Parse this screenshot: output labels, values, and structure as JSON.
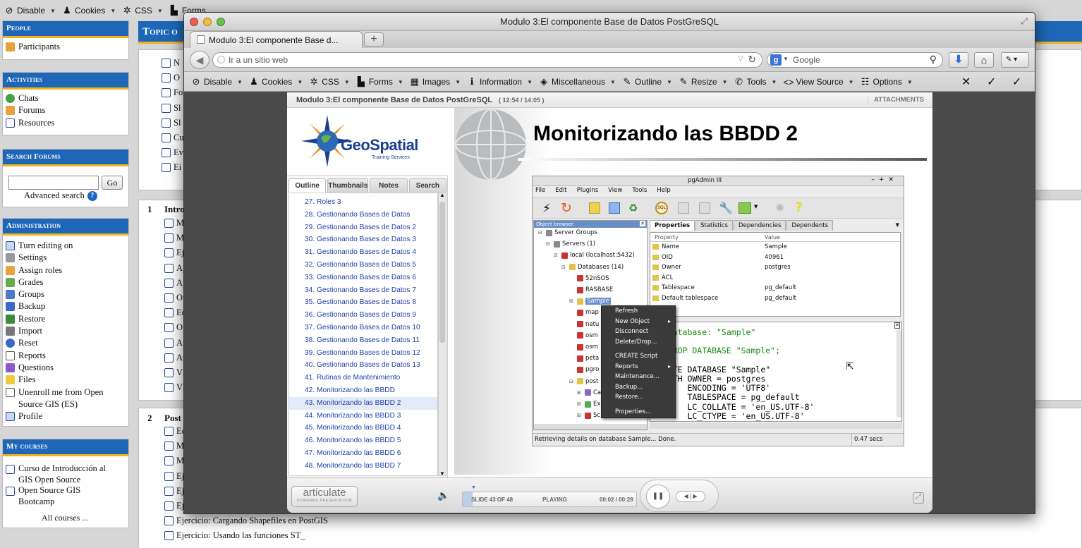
{
  "webdev_toolbar": {
    "items": [
      "Disable",
      "Cookies",
      "CSS",
      "Forms",
      "Images",
      "Information",
      "Miscellaneous",
      "Outline",
      "Resize",
      "Tools",
      "View Source",
      "Options"
    ]
  },
  "moodle": {
    "topic_header": "Topic o",
    "blocks": {
      "people": {
        "title": "People",
        "items": [
          "Participants"
        ]
      },
      "activities": {
        "title": "Activities",
        "items": [
          "Chats",
          "Forums",
          "Resources"
        ]
      },
      "search": {
        "title": "Search Forums",
        "button": "Go",
        "advanced": "Advanced search"
      },
      "admin": {
        "title": "Administration",
        "items": [
          "Turn editing on",
          "Settings",
          "Assign roles",
          "Grades",
          "Groups",
          "Backup",
          "Restore",
          "Import",
          "Reset",
          "Reports",
          "Questions",
          "Files",
          "Unenroll me from Open",
          "Source GIS (ES)",
          "Profile"
        ]
      },
      "courses": {
        "title": "My courses",
        "items": [
          "Curso de Introducción al",
          "GIS Open Source",
          "Open Source GIS",
          "Bootcamp"
        ],
        "all": "All courses ..."
      }
    },
    "topic1_num": "1",
    "topic1_title": "Intro",
    "topic2_num": "2",
    "topic2_title": "Post",
    "topic0_items": [
      "N",
      "O",
      "Fo",
      "Sl",
      "Sl",
      "Cu",
      "Ev",
      "Ei"
    ],
    "topic1_items": [
      "M",
      "M",
      "Ej",
      "Ap",
      "Ap",
      "O",
      "Ec",
      "O",
      "Ar",
      "Ap",
      "VI",
      "VI"
    ],
    "topic2_items": [
      "Ec",
      "M",
      "M",
      "Ej",
      "Ej",
      "Ej",
      "Ejercicio: Cargando Shapefiles en PostGIS",
      "Ejercicio: Usando las funciones ST_"
    ]
  },
  "browser": {
    "title": "Modulo 3:El componente Base de Datos PostGreSQL",
    "tab_label": "Modulo 3:El componente Base d...",
    "tab_add": "+",
    "url_placeholder": "Ir a un sitio web",
    "search_placeholder": "Google"
  },
  "player": {
    "header_title": "Modulo 3:El componente Base de Datos PostGreSQL",
    "header_time": "( 12:54 / 14:05 )",
    "attachments": "ATTACHMENTS",
    "logo_text": "GeoSpatial",
    "logo_sub": "Training Services",
    "tabs": [
      "Outline",
      "Thumbnails",
      "Notes",
      "Search"
    ],
    "outline": [
      "27. Roles 3",
      "28. Gestionando Bases de Datos",
      "29. Gestionando Bases de Datos 2",
      "30. Gestionando Bases de Datos 3",
      "31. Gestionando Bases de Datos 4",
      "32. Gestionando Bases de Datos 5",
      "33. Gestionando Bases de Datos 6",
      "34. Gestionando Bases de Datos 7",
      "35. Gestionando Bases de Datos 8",
      "36. Gestionando Bases de Datos 9",
      "37. Gestionando Bases de Datos 10",
      "38. Gestionando Bases de Datos 11",
      "39. Gestionando Bases de Datos 12",
      "40. Gestionando Bases de Datos 13",
      "41. Rutinas de Mantenimiento",
      "42. Monitorizando las BBDD",
      "43. Monitorizando las BBDD 2",
      "44. Monitorizando las BBDD 3",
      "45. Monitorizando las BBDD 4",
      "46. Monitorizando las BBDD 5",
      "47. Monitorizando las BBDD 6",
      "48. Monitorizando las BBDD 7"
    ],
    "selected_index": 16,
    "slide_title": "Monitorizando las BBDD 2",
    "footer": {
      "brand": "articulate",
      "brand_sub": "POWERED PRESENTATION",
      "slide": "SLIDE 43 OF 48",
      "status": "PLAYING",
      "time": "00:02 / 00:28"
    }
  },
  "pgadmin": {
    "title": "pgAdmin III",
    "menu": [
      "File",
      "Edit",
      "Plugins",
      "View",
      "Tools",
      "Help"
    ],
    "object_browser": "Object browser",
    "tree": [
      {
        "label": "Server Groups",
        "indent": 0,
        "exp": "⊟",
        "color": "#888"
      },
      {
        "label": "Servers (1)",
        "indent": 1,
        "exp": "⊟",
        "color": "#888"
      },
      {
        "label": "local (localhost:5432)",
        "indent": 2,
        "exp": "⊟",
        "color": "#c33"
      },
      {
        "label": "Databases (14)",
        "indent": 3,
        "exp": "⊟",
        "color": "#e2c44c"
      },
      {
        "label": "52nSOS",
        "indent": 4,
        "exp": "",
        "color": "#c33"
      },
      {
        "label": "RASBASE",
        "indent": 4,
        "exp": "",
        "color": "#c33"
      },
      {
        "label": "Sample",
        "indent": 4,
        "exp": "⊞",
        "color": "#e2c44c",
        "sel": true
      },
      {
        "label": "map",
        "indent": 4,
        "exp": "",
        "color": "#c33"
      },
      {
        "label": "natu",
        "indent": 4,
        "exp": "",
        "color": "#c33"
      },
      {
        "label": "osm",
        "indent": 4,
        "exp": "",
        "color": "#c33"
      },
      {
        "label": "osm",
        "indent": 4,
        "exp": "",
        "color": "#c33"
      },
      {
        "label": "peta",
        "indent": 4,
        "exp": "",
        "color": "#c33"
      },
      {
        "label": "pgro",
        "indent": 4,
        "exp": "",
        "color": "#c33"
      },
      {
        "label": "post",
        "indent": 4,
        "exp": "⊟",
        "color": "#e2c44c"
      },
      {
        "label": "Ca",
        "indent": 5,
        "exp": "⊞",
        "color": "#86c"
      },
      {
        "label": "Ex",
        "indent": 5,
        "exp": "⊞",
        "color": "#5a5"
      },
      {
        "label": "Sc",
        "indent": 5,
        "exp": "⊞",
        "color": "#c33"
      }
    ],
    "prop_tabs": [
      "Properties",
      "Statistics",
      "Dependencies",
      "Dependents"
    ],
    "prop_head": [
      "Property",
      "Value"
    ],
    "props": [
      [
        "Name",
        "Sample"
      ],
      [
        "OID",
        "40961"
      ],
      [
        "Owner",
        "postgres"
      ],
      [
        "ACL",
        ""
      ],
      [
        "Tablespace",
        "pg_default"
      ],
      [
        "Default tablespace",
        "pg_default"
      ]
    ],
    "sql_lines": [
      "-- Database: \"Sample\"",
      "",
      "-- DROP DATABASE \"Sample\";",
      "",
      "CREATE DATABASE \"Sample\"",
      "  WITH OWNER = postgres",
      "       ENCODING = 'UTF8'",
      "       TABLESPACE = pg_default",
      "       LC_COLLATE = 'en_US.UTF-8'",
      "       LC_CTYPE = 'en_US.UTF-8'"
    ],
    "context_menu": [
      "Refresh",
      "New Object",
      "Disconnect",
      "Delete/Drop...",
      "CREATE Script",
      "Reports",
      "Maintenance...",
      "Backup...",
      "Restore...",
      "Properties..."
    ],
    "status": "Retrieving details on database Sample... Done.",
    "status_time": "0.47 secs"
  }
}
